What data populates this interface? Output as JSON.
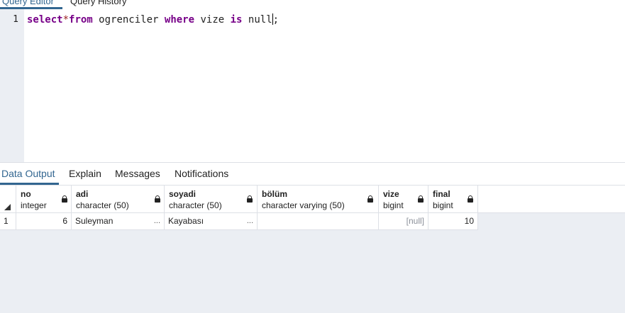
{
  "top_tabs": [
    {
      "label": "Query Editor"
    },
    {
      "label": "Query History"
    }
  ],
  "editor": {
    "line_number": "1",
    "tokens": {
      "select": "select",
      "star": "*",
      "from": "from",
      "table": " ogrenciler ",
      "where": "where",
      "col": " vize ",
      "is": "is",
      "null_start": " nul",
      "null_end": "l",
      "semicolon": ";"
    }
  },
  "results_tabs": [
    {
      "label": "Data Output"
    },
    {
      "label": "Explain"
    },
    {
      "label": "Messages"
    },
    {
      "label": "Notifications"
    }
  ],
  "grid": {
    "columns": [
      {
        "name": "no",
        "type": "integer"
      },
      {
        "name": "adi",
        "type": "character (50)"
      },
      {
        "name": "soyadi",
        "type": "character (50)"
      },
      {
        "name": "bölüm",
        "type": "character varying (50)"
      },
      {
        "name": "vize",
        "type": "bigint"
      },
      {
        "name": "final",
        "type": "bigint"
      }
    ],
    "rows": [
      {
        "row_num": "1",
        "no": "6",
        "adi": "Suleyman",
        "soyadi": "Kayabası",
        "bolum": "",
        "vize": "[null]",
        "final": "10"
      }
    ],
    "ellipsis": "..."
  },
  "colors": {
    "accent": "#326690",
    "keyword": "#770088",
    "operator": "#981a1a",
    "panel_bg": "#ebeef3"
  }
}
